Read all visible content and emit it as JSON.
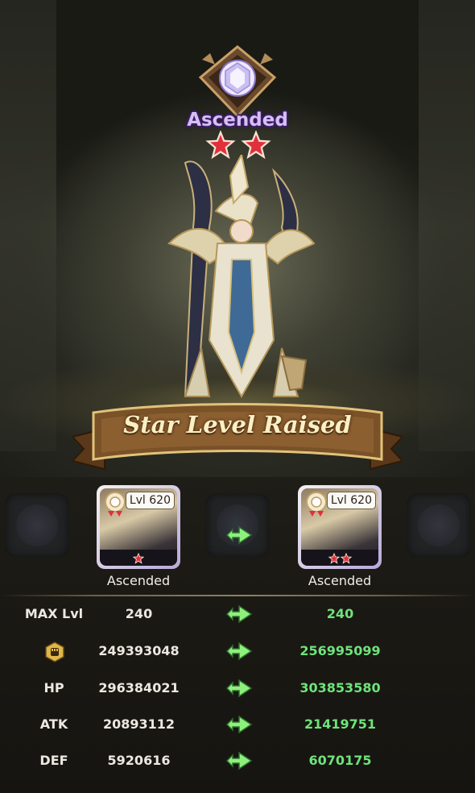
{
  "header": {
    "rank_label": "Ascended",
    "rank_stars": 2
  },
  "banner": {
    "title": "Star Level Raised"
  },
  "hero_cards": {
    "before": {
      "level": "Lvl 620",
      "rank": "Ascended",
      "stars": 1
    },
    "after": {
      "level": "Lvl 620",
      "rank": "Ascended",
      "stars": 2
    }
  },
  "stats": [
    {
      "label": "MAX Lvl",
      "old": "240",
      "new": "240"
    },
    {
      "label": "",
      "icon": "power-fist-icon",
      "old": "249393048",
      "new": "256995099"
    },
    {
      "label": "HP",
      "old": "296384021",
      "new": "303853580"
    },
    {
      "label": "ATK",
      "old": "20893112",
      "new": "21419751"
    },
    {
      "label": "DEF",
      "old": "5920616",
      "new": "6070175"
    }
  ],
  "colors": {
    "increase_green": "#6ee37a",
    "arrow_green": "#8df07c",
    "star_red": "#e0303c",
    "rank_purple": "#d7bff5"
  }
}
